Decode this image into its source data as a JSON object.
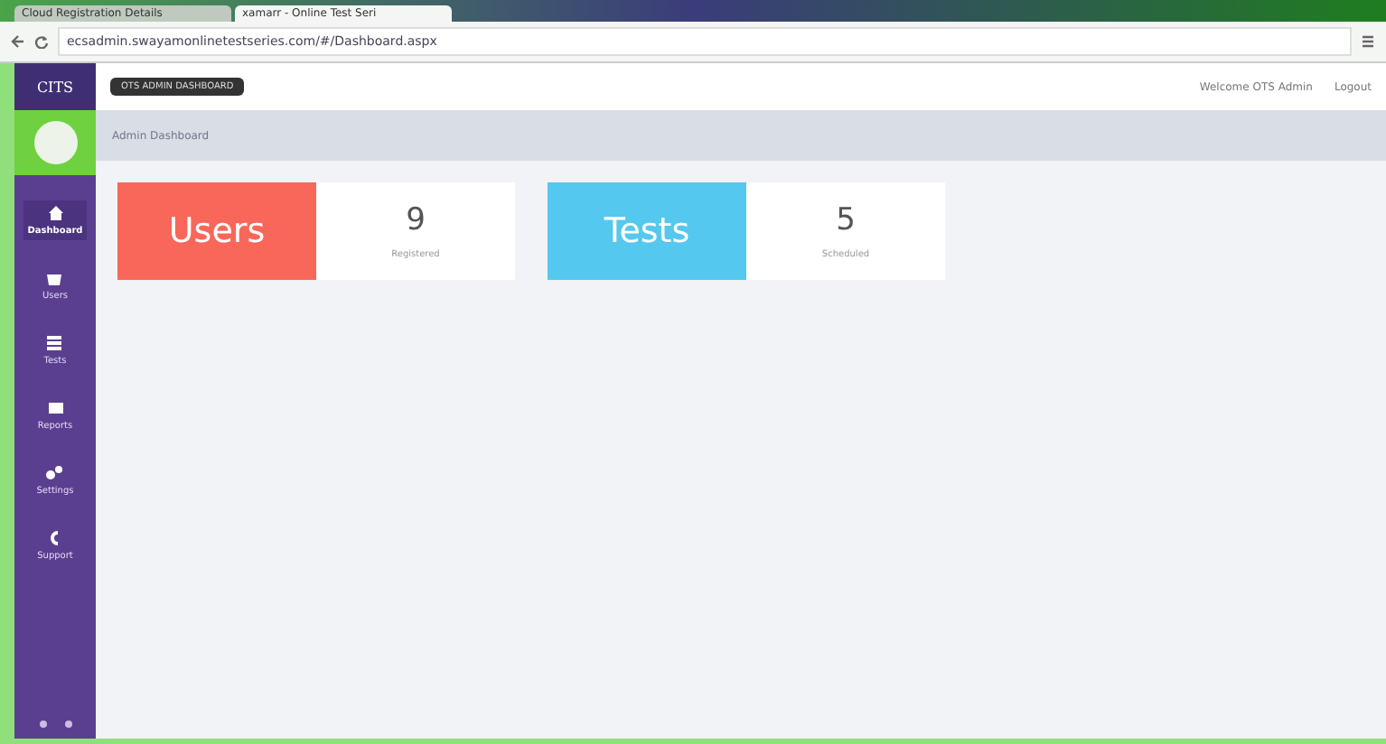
{
  "browser": {
    "tabs": [
      {
        "title": "Cloud Registration Details",
        "selected": false
      },
      {
        "title": "xamarr - Online Test Seri",
        "selected": true
      }
    ],
    "url": "ecsadmin.swayamonlinetestseries.com/#/Dashboard.aspx"
  },
  "app": {
    "logo": "CITS",
    "badge": "OTS ADMIN DASHBOARD",
    "welcome": "Welcome OTS Admin",
    "logout": "Logout",
    "breadcrumb": "Admin Dashboard",
    "nav": [
      {
        "label": "Dashboard",
        "selected": true
      },
      {
        "label": "Users",
        "selected": false
      },
      {
        "label": "Tests",
        "selected": false
      },
      {
        "label": "Reports",
        "selected": false
      },
      {
        "label": "Settings",
        "selected": false
      },
      {
        "label": "Support",
        "selected": false
      }
    ],
    "stats": [
      {
        "title": "Users",
        "count": "9",
        "caption": "Registered",
        "color": "#f9675a"
      },
      {
        "title": "Tests",
        "count": "5",
        "caption": "Scheduled",
        "color": "#55c8ef"
      }
    ]
  }
}
